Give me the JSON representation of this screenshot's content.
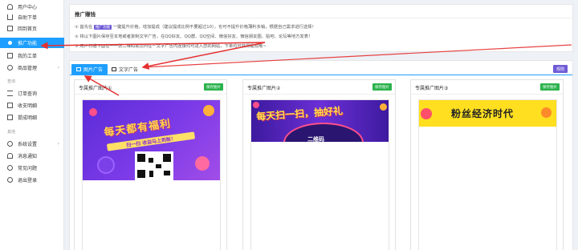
{
  "sidebar": {
    "items": [
      {
        "label": "用户中心",
        "icon": "user-icon"
      },
      {
        "label": "自助下单",
        "icon": "cart-icon"
      },
      {
        "label": "回到首页",
        "icon": "home-icon"
      },
      {
        "label": "推广功能",
        "icon": "dot-icon",
        "active": true
      },
      {
        "label": "我的工单",
        "icon": "doc-icon"
      },
      {
        "label": "商品管理",
        "icon": "gear-icon",
        "arrow": "›"
      },
      {
        "label": "订单查询",
        "icon": "list-icon"
      },
      {
        "label": "收支明细",
        "icon": "box-icon"
      },
      {
        "label": "提成明细",
        "icon": "box-icon"
      },
      {
        "label": "系统设置",
        "icon": "gear-icon",
        "arrow": "›"
      },
      {
        "label": "消息通知",
        "icon": "bell-icon"
      },
      {
        "label": "常见问题",
        "icon": "help-icon"
      },
      {
        "label": "退出登录",
        "icon": "exit-icon"
      }
    ],
    "groups": [
      "查询",
      "其他"
    ]
  },
  "promo": {
    "title": "推广赚钱",
    "line1_pre": "① 首先在",
    "line1_badge": "推广功能",
    "line1_post": "一键提升价格，增加提成（建议提成比例不要超过10），也可不提升价格薄利多销，根据自己需求进行选择！",
    "line2": "② 将以下图片保存至本地或者复制文字广告，在QQ好友、QQ群、QQ空间、微信好友、微信朋友圈、贴吧、论坛等地方发表！",
    "line3": "③ 用户扫描下面任一一张二维码或访问任一文字广告内连接均可进入您的网站，下单均可获得提成哦~"
  },
  "tabs": [
    {
      "label": "图片广告",
      "active": true
    },
    {
      "label": "文字广告",
      "active": false
    }
  ],
  "rule_button": "规则",
  "cards": [
    {
      "title": "专属推广图片①",
      "save": "保存图片",
      "poster_title": "每天都有福利",
      "poster_sub": "扫一扫 收益马上到账！"
    },
    {
      "title": "专属推广图片②",
      "save": "保存图片",
      "poster_title": "每天扫一扫，抽好礼",
      "poster_sub": "二维码"
    },
    {
      "title": "专属推广图片③",
      "save": "保存图片",
      "poster_title": "粉丝经济时代"
    }
  ],
  "colors": {
    "accent": "#1e9fff",
    "save": "#2bb24c",
    "rule": "#6f5bd6",
    "arrow": "#e53030"
  }
}
